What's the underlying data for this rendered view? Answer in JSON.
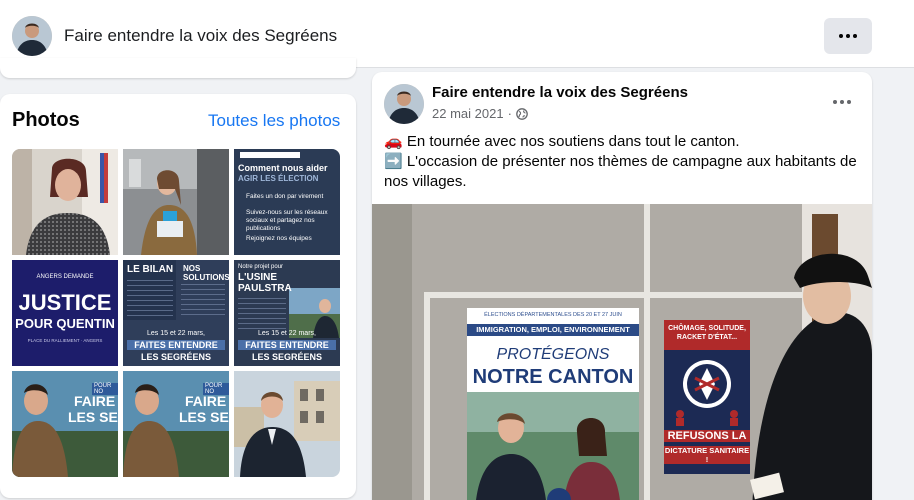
{
  "header": {
    "page_name": "Faire entendre la voix des Segréens",
    "more_label": "···"
  },
  "photos": {
    "title": "Photos",
    "see_all": "Toutes les photos",
    "tiles": [
      {
        "label": "woman-portrait"
      },
      {
        "label": "campaigner-with-leaflets"
      },
      {
        "label": "Comment nous aider"
      },
      {
        "label": "Justice pour Quentin"
      },
      {
        "label": "Le bilan / Nos solutions"
      },
      {
        "label": "Notre projet pour l'usine Paulstra"
      },
      {
        "label": "Faire les Se"
      },
      {
        "label": "Faire les Se"
      },
      {
        "label": "candidate-outdoor"
      }
    ],
    "tile3_heading": "Comment nous aider",
    "tile3_sub": "AGIR LES ÉLECTION",
    "tile3_lines": [
      "Faites un don par virement",
      "Suivez-nous sur les réseaux sociaux et partagez nos publications",
      "Rejoignez nos équipes"
    ],
    "tile4_top": "ANGERS DEMANDE",
    "tile4_main1": "JUSTICE",
    "tile4_main2": "POUR QUENTIN",
    "tile4_small": "PLACE DU RALLIEMENT · ANGERS",
    "tile5_left": "LE BILAN",
    "tile5_right": "NOS SOLUTIONS",
    "tile5_dates": "Les 15 et 22 mars,",
    "tile5_slogan": "FAITES ENTENDRE",
    "tile5_slogan2": "LES SEGRÉENS",
    "tile6_head1": "Notre projet pour",
    "tile6_head2": "L'USINE",
    "tile6_head3": "PAULSTRA",
    "tile6_dates": "Les 15 et 22 mars,",
    "tile6_slogan": "FAITES ENTENDRE",
    "tile6_slogan2": "LES SEGRÉENS",
    "tile7_small": "POUR NO",
    "tile7_big1": "FAIRE",
    "tile7_big2": "LES SE"
  },
  "post": {
    "author": "Faire entendre la voix des Segréens",
    "date": "22 mai 2021",
    "separator": "·",
    "line1": "🚗 En tournée avec nos soutiens dans tout le canton.",
    "line2": "➡️ L'occasion de présenter nos thèmes de campagne aux habitants de",
    "line3": "nos villages.",
    "poster1_top": "ÉLECTIONS DÉPARTEMENTALES DES 20 ET 27 JUIN",
    "poster1_band": "IMMIGRATION, EMPLOI, ENVIRONNEMENT",
    "poster1_title1": "PROTÉGEONS",
    "poster1_title2": "NOTRE CANTON !",
    "poster2_top": "CHÔMAGE, SOLITUDE, RACKET D'ÉTAT...",
    "poster2_bottom1": "REFUSONS LA",
    "poster2_bottom2": "DICTATURE SANITAIRE !"
  }
}
